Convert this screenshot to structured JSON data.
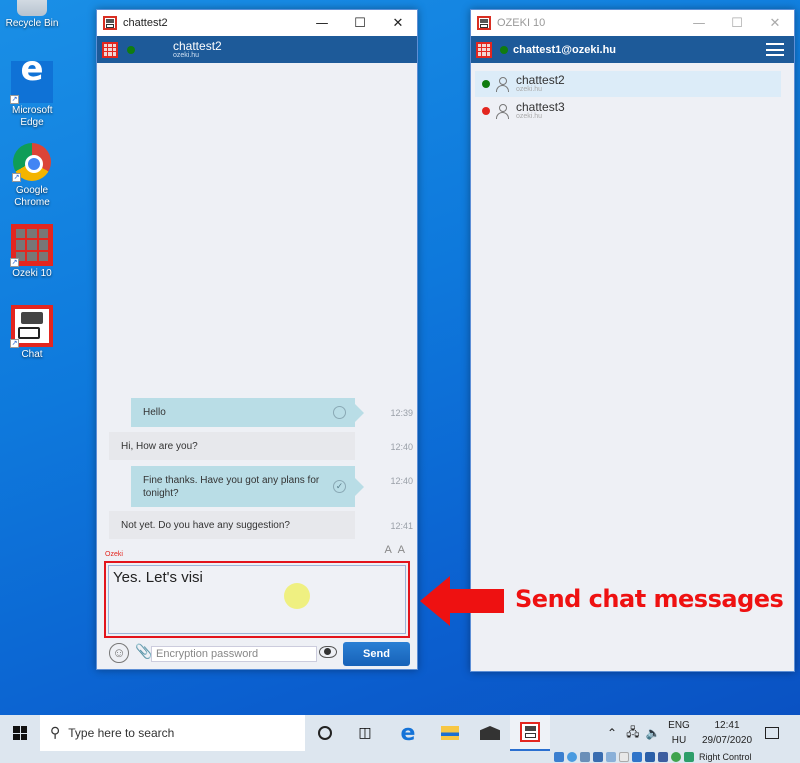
{
  "desktop": {
    "icons": [
      {
        "label": "Recycle Bin",
        "icon": "recycle-bin-icon"
      },
      {
        "label": "Microsoft Edge",
        "icon": "edge-icon"
      },
      {
        "label": "Google Chrome",
        "icon": "chrome-icon"
      },
      {
        "label": "Ozeki 10",
        "icon": "ozeki-icon"
      },
      {
        "label": "Chat",
        "icon": "chat-icon"
      }
    ]
  },
  "chat_window": {
    "title": "chattest2",
    "header": {
      "name": "chattest2",
      "domain": "ozeki.hu",
      "status": "online"
    },
    "messages": [
      {
        "direction": "out",
        "text": "Hello",
        "time": "12:39",
        "status": "sent"
      },
      {
        "direction": "in",
        "text": "Hi, How are you?",
        "time": "12:40"
      },
      {
        "direction": "out",
        "text": "Fine thanks. Have you got any plans for tonight?",
        "time": "12:40",
        "status": "delivered"
      },
      {
        "direction": "in",
        "text": "Not yet. Do you have any suggestion?",
        "time": "12:41"
      }
    ],
    "font_size_label": "A A",
    "sender_label": "Ozeki",
    "compose_value": "Yes. Let's visi",
    "encryption_placeholder": "Encryption password",
    "send_label": "Send"
  },
  "main_window": {
    "title": "OZEKI 10",
    "account": "chattest1@ozeki.hu",
    "contacts": [
      {
        "name": "chattest2",
        "domain": "ozeki.hu",
        "status": "online",
        "status_color": "#107c10",
        "selected": true
      },
      {
        "name": "chattest3",
        "domain": "ozeki.hu",
        "status": "offline",
        "status_color": "#e3261f",
        "selected": false
      }
    ]
  },
  "annotation": {
    "text": "Send chat messages",
    "color": "#ee1111"
  },
  "taskbar": {
    "search_placeholder": "Type here to search",
    "language_top": "ENG",
    "language_bottom": "HU",
    "time": "12:41",
    "date": "29/07/2020",
    "host_key_label": "Right Control"
  }
}
